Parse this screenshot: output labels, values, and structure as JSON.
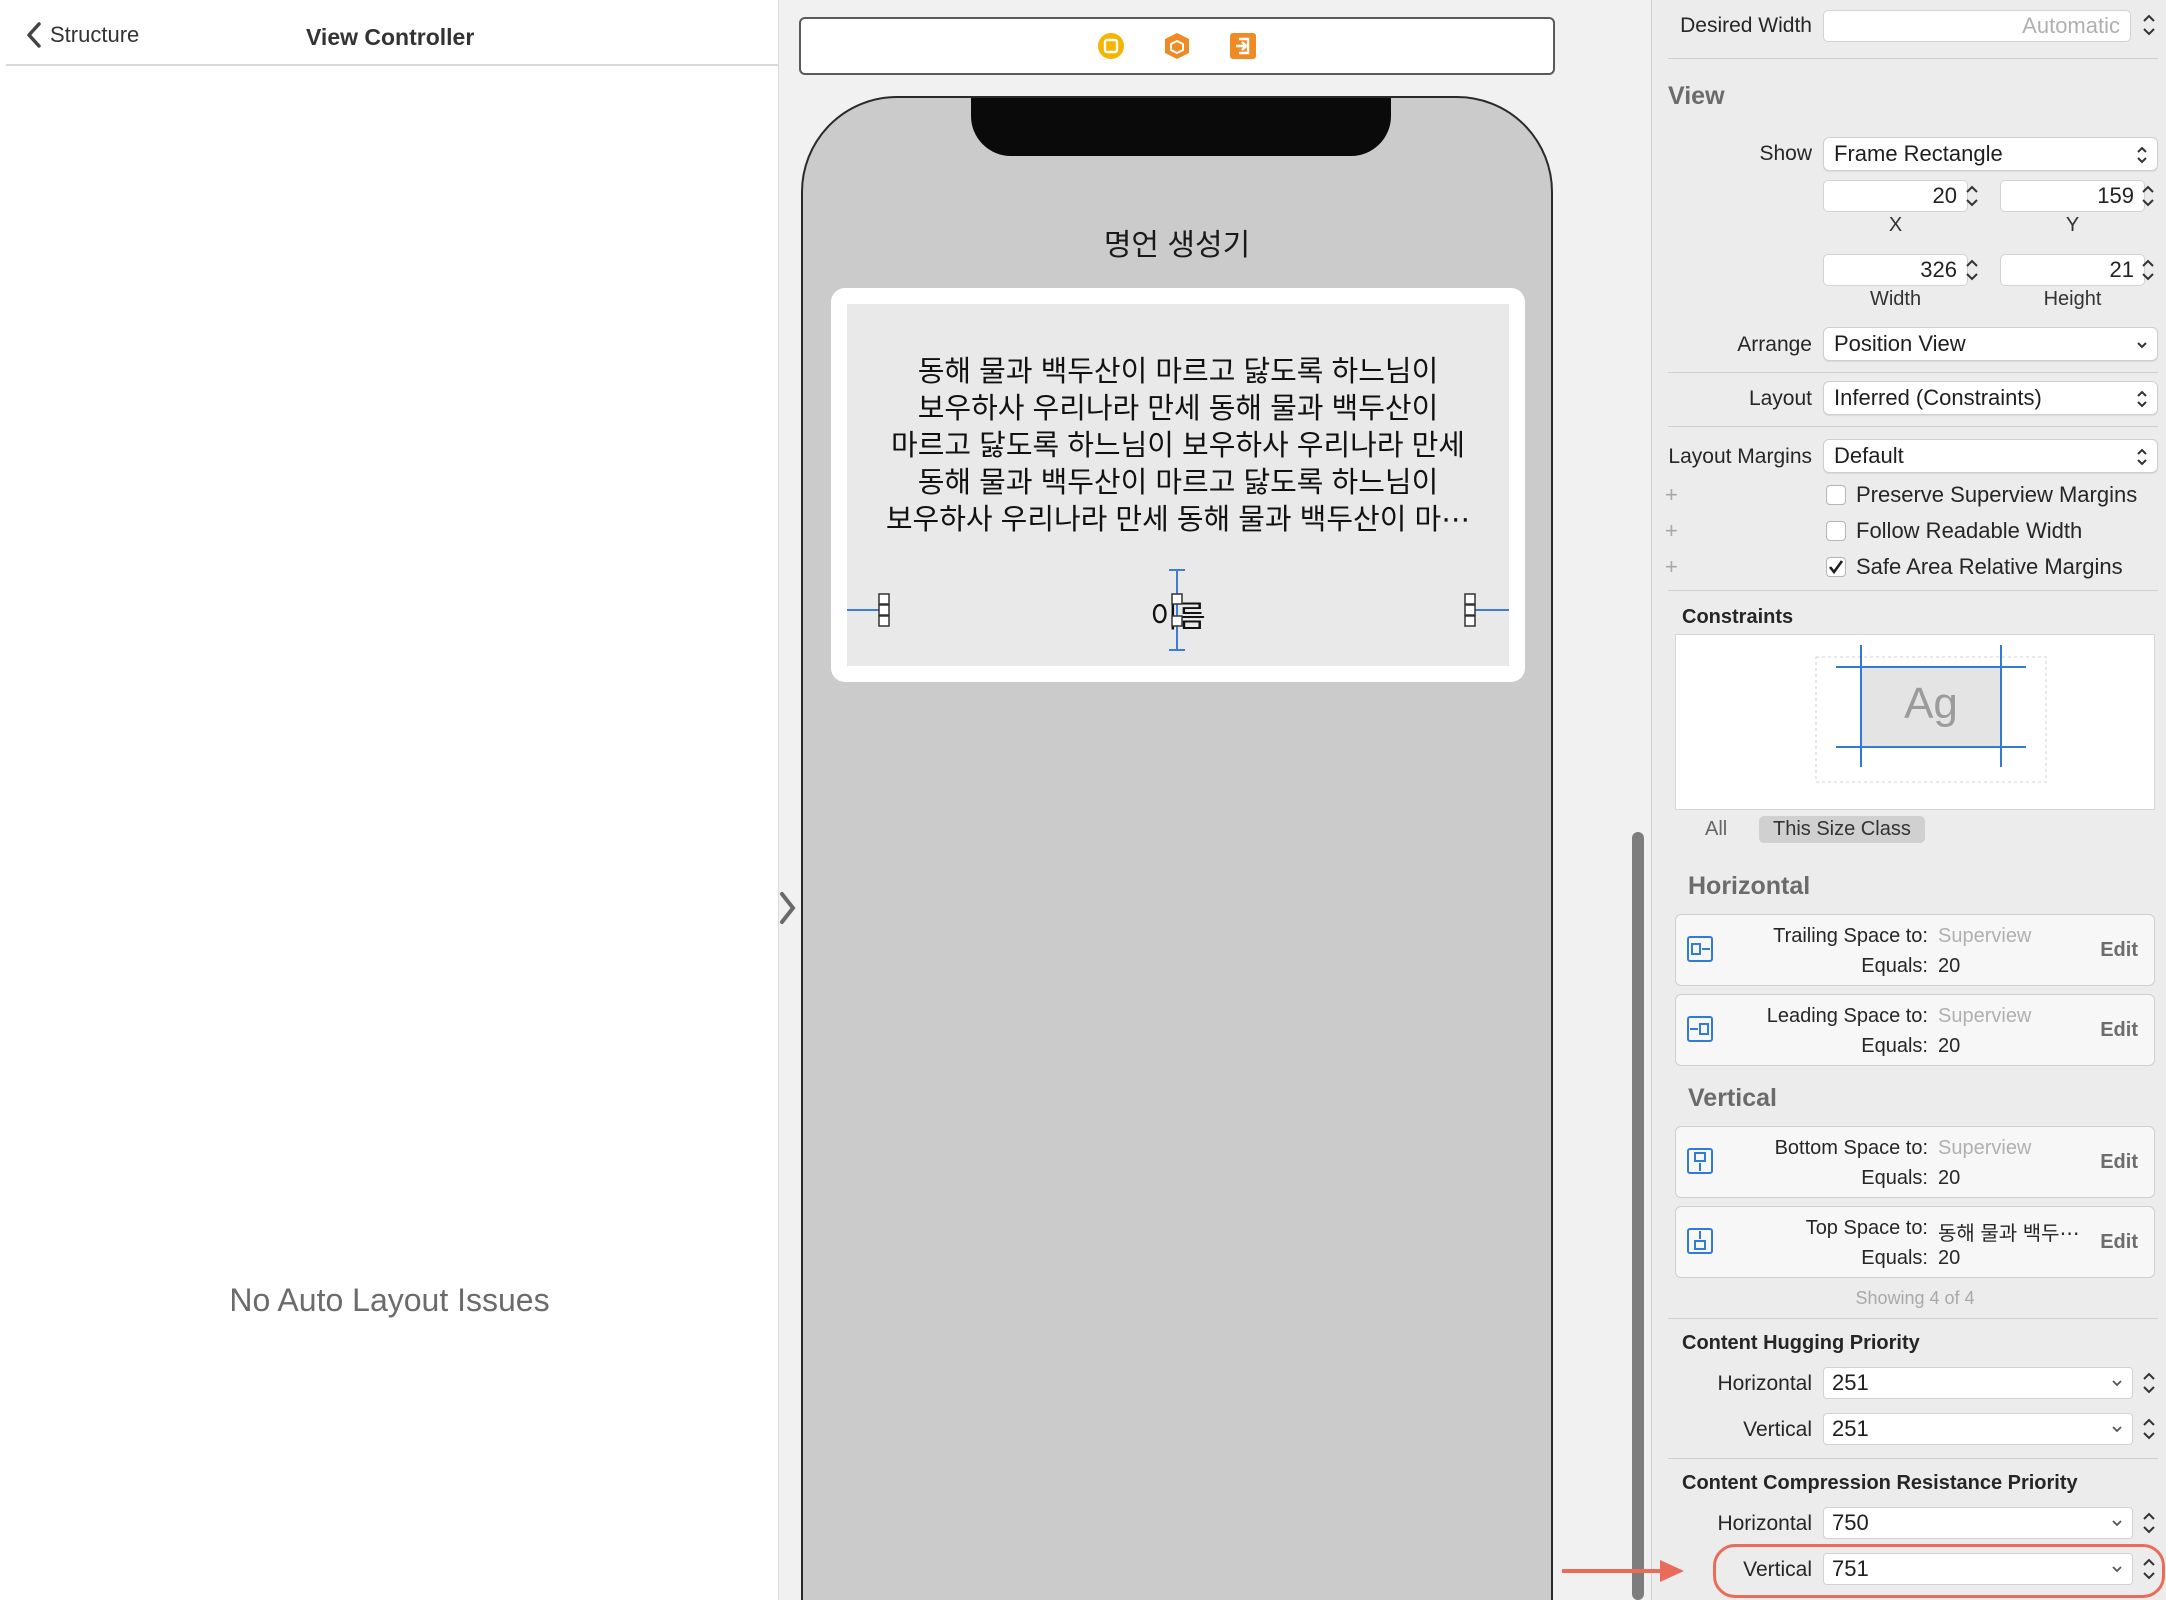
{
  "structure_panel": {
    "back_label": "Structure",
    "title": "View Controller",
    "empty_message": "No Auto Layout Issues"
  },
  "canvas": {
    "toolbar_icons": [
      "view-controller-icon",
      "first-responder-icon",
      "exit-icon"
    ],
    "nav_title": "명언 생성기",
    "quote_lines": [
      "동해 물과 백두산이 마르고 닳도록 하느님이",
      "보우하사 우리나라 만세 동해 물과 백두산이",
      "마르고 닳도록 하느님이 보우하사 우리나라 만세",
      "동해 물과 백두산이 마르고 닳도록 하느님이",
      "보우하사 우리나라 만세 동해 물과 백두산이 마⋯"
    ],
    "name_label": "이름"
  },
  "inspector": {
    "desired_width": {
      "label": "Desired Width",
      "placeholder": "Automatic"
    },
    "view": {
      "title": "View",
      "show_label": "Show",
      "show_value": "Frame Rectangle",
      "x": "20",
      "x_label": "X",
      "y": "159",
      "y_label": "Y",
      "width": "326",
      "width_label": "Width",
      "height": "21",
      "height_label": "Height",
      "arrange_label": "Arrange",
      "arrange_value": "Position View",
      "layout_label": "Layout",
      "layout_value": "Inferred (Constraints)",
      "margins_label": "Layout Margins",
      "margins_value": "Default",
      "preserve_label": "Preserve Superview Margins",
      "readable_label": "Follow Readable Width",
      "safe_area_label": "Safe Area Relative Margins"
    },
    "constraints": {
      "title": "Constraints",
      "preview_text": "Ag",
      "tab_all": "All",
      "tab_this": "This Size Class"
    },
    "horizontal": {
      "title": "Horizontal",
      "items": [
        {
          "title": "Trailing Space to:",
          "target": "Superview",
          "equals_label": "Equals:",
          "value": "20",
          "edit": "Edit"
        },
        {
          "title": "Leading Space to:",
          "target": "Superview",
          "equals_label": "Equals:",
          "value": "20",
          "edit": "Edit"
        }
      ]
    },
    "vertical": {
      "title": "Vertical",
      "items": [
        {
          "title": "Bottom Space to:",
          "target": "Superview",
          "equals_label": "Equals:",
          "value": "20",
          "edit": "Edit"
        },
        {
          "title": "Top Space to:",
          "target": "동해 물과 백두⋯",
          "equals_label": "Equals:",
          "value": "20",
          "edit": "Edit"
        }
      ]
    },
    "showing": "Showing 4 of 4",
    "hugging": {
      "title": "Content Hugging Priority",
      "horizontal_label": "Horizontal",
      "horizontal_value": "251",
      "vertical_label": "Vertical",
      "vertical_value": "251"
    },
    "compression": {
      "title": "Content Compression Resistance Priority",
      "horizontal_label": "Horizontal",
      "horizontal_value": "750",
      "vertical_label": "Vertical",
      "vertical_value": "751"
    }
  },
  "colors": {
    "accent_blue": "#2f7bd6",
    "annotation_red": "#ea6b5a",
    "device_background": "#cbcbcb"
  }
}
